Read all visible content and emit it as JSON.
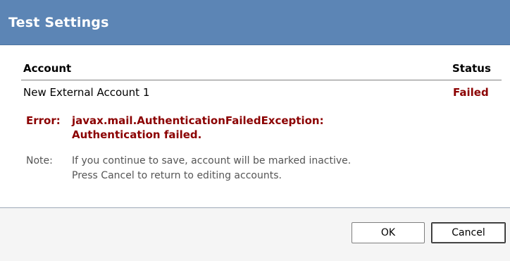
{
  "dialog": {
    "title": "Test Settings"
  },
  "table": {
    "headers": {
      "account": "Account",
      "status": "Status"
    },
    "rows": [
      {
        "account": "New External Account 1",
        "status": "Failed"
      }
    ]
  },
  "error": {
    "label": "Error:",
    "message": "javax.mail.AuthenticationFailedException: Authentication failed."
  },
  "note": {
    "label": "Note:",
    "line1": "If you continue to save, account will be marked inactive.",
    "line2": "Press Cancel to return to editing accounts."
  },
  "buttons": {
    "ok": "OK",
    "cancel": "Cancel"
  },
  "colors": {
    "title_bar": "#5c85b5",
    "error": "#8b0000",
    "note": "#555555"
  }
}
